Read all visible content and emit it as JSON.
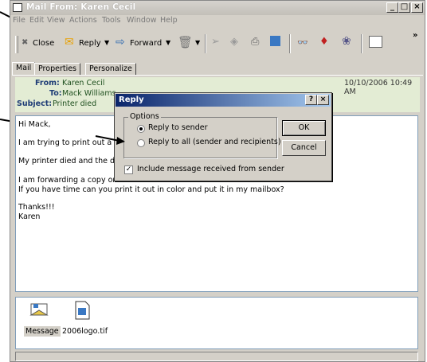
{
  "window": {
    "title": "Mail From: Karen Cecil"
  },
  "menu": [
    "File",
    "Edit",
    "View",
    "Actions",
    "Tools",
    "Window",
    "Help"
  ],
  "toolbar": {
    "close": "Close",
    "reply": "Reply",
    "forward": "Forward",
    "more": "»"
  },
  "tabs": [
    "Mail",
    "Properties",
    "Personalize"
  ],
  "header": {
    "from_label": "From:",
    "from": "Karen Cecil",
    "to_label": "To:",
    "to": "Mack Williams",
    "subject_label": "Subject:",
    "subject": "Printer died",
    "date": "10/10/2006 10:49 AM"
  },
  "body": {
    "line1": "Hi Mack,",
    "line2": "I am trying to print out a ",
    "line3": "My printer died and the dep",
    "line4": "I am forwarding a copy on t",
    "line5": "If you have time can you print it out in color and put it in my mailbox?",
    "line6": "Thanks!!!",
    "line7": "Karen"
  },
  "attachments": [
    {
      "name": "Message"
    },
    {
      "name": "2006logo.tif"
    }
  ],
  "dialog": {
    "title": "Reply",
    "help": "?",
    "close": "×",
    "group": "Options",
    "opt1": "Reply to sender",
    "opt2": "Reply to all (sender and recipients)",
    "selected": "Reply to sender",
    "include": "Include message received from sender",
    "include_checked": true,
    "ok": "OK",
    "cancel": "Cancel"
  }
}
